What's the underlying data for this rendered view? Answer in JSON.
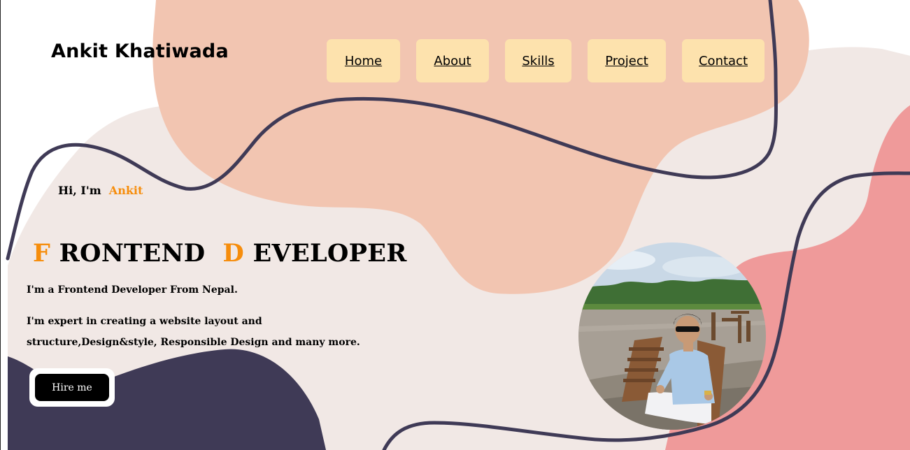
{
  "header": {
    "brand": "Ankit Khatiwada"
  },
  "nav": {
    "items": [
      {
        "label": "Home"
      },
      {
        "label": "About"
      },
      {
        "label": "Skills"
      },
      {
        "label": "Project"
      },
      {
        "label": "Contact"
      }
    ]
  },
  "hero": {
    "greeting_prefix": "Hi, I'm ",
    "greeting_name": "Ankit",
    "title_initial_1": "F",
    "title_rest_1": "RONTEND",
    "title_initial_2": "D",
    "title_rest_2": "EVELOPER",
    "line1": "I'm a Frontend Developer From Nepal.",
    "line2": "I'm expert in creating a website layout and structure,Design&style, Responsible Design and many more.",
    "hire_label": "Hire me"
  },
  "colors": {
    "accent": "#f68d0c",
    "peach_blob": "#f2c5b1",
    "cream_blob": "#f1e8e5",
    "pink_blob": "#ef9a9a",
    "navy_blob": "#3f3a56",
    "nav_button": "#fde2ad"
  },
  "icons": {
    "profile_photo": "person-by-river-photo"
  }
}
